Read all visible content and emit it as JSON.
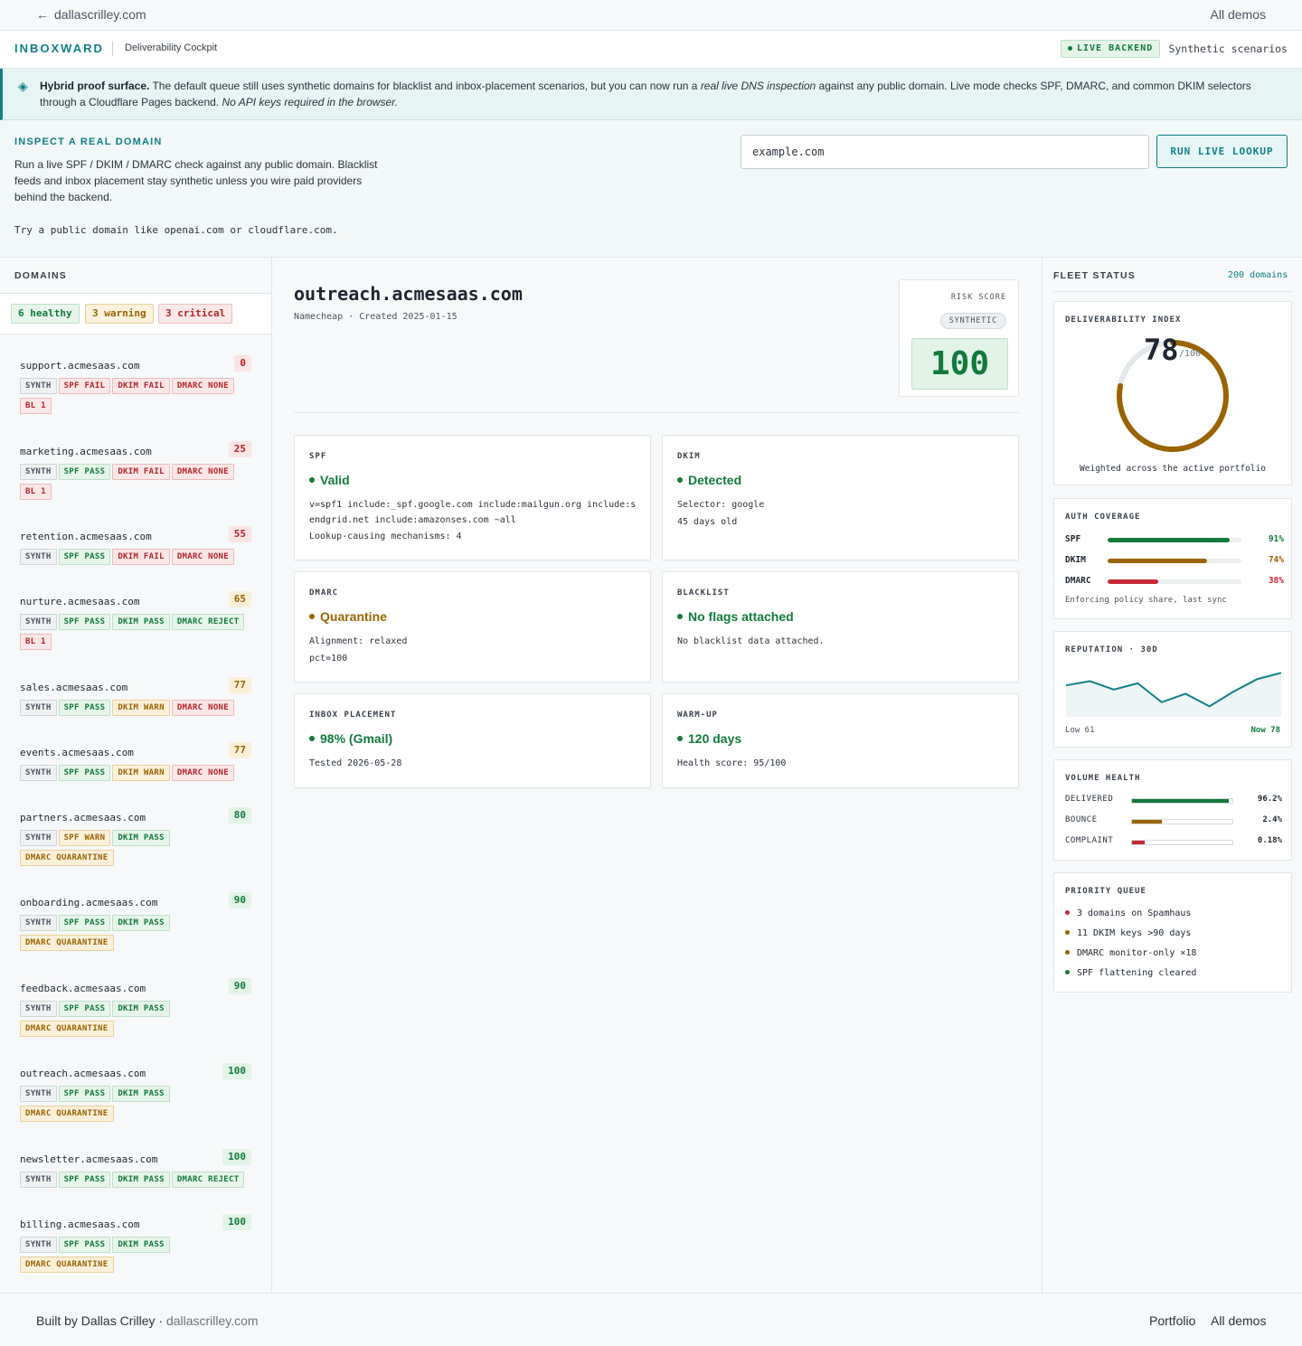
{
  "topbar": {
    "back_label": "dallascrilley.com",
    "all_demos": "All demos"
  },
  "header": {
    "brand": "INBOXWARD",
    "subtitle": "Deliverability Cockpit",
    "live_badge": "LIVE BACKEND",
    "mode_label": "Synthetic scenarios"
  },
  "banner": {
    "lead": "Hybrid proof surface.",
    "text1": " The default queue still uses synthetic domains for blacklist and inbox-placement scenarios, but you can now run a ",
    "em1": "real live DNS inspection",
    "text2": " against any public domain. Live mode checks SPF, DMARC, and common DKIM selectors through a Cloudflare Pages backend. ",
    "em2": "No API keys required in the browser."
  },
  "inspect": {
    "title": "INSPECT A REAL DOMAIN",
    "description": "Run a live SPF / DKIM / DMARC check against any public domain. Blacklist feeds and inbox placement stay synthetic unless you wire paid providers behind the backend.",
    "hint": "Try a public domain like openai.com or cloudflare.com.",
    "input_value": "example.com",
    "button": "RUN LIVE LOOKUP"
  },
  "domains": {
    "title": "DOMAINS",
    "filters": {
      "healthy": "6 healthy",
      "warning": "3 warning",
      "critical": "3 critical"
    },
    "items": [
      {
        "name": "support.acmesaas.com",
        "score": "0",
        "level": "crit",
        "tags": [
          [
            "SYNTH",
            "synth"
          ],
          [
            "SPF FAIL",
            "fail"
          ],
          [
            "DKIM FAIL",
            "fail"
          ],
          [
            "DMARC NONE",
            "fail"
          ],
          [
            "BL 1",
            "fail"
          ]
        ]
      },
      {
        "name": "marketing.acmesaas.com",
        "score": "25",
        "level": "crit",
        "tags": [
          [
            "SYNTH",
            "synth"
          ],
          [
            "SPF PASS",
            "pass"
          ],
          [
            "DKIM FAIL",
            "fail"
          ],
          [
            "DMARC NONE",
            "fail"
          ],
          [
            "BL 1",
            "fail"
          ]
        ]
      },
      {
        "name": "retention.acmesaas.com",
        "score": "55",
        "level": "crit",
        "tags": [
          [
            "SYNTH",
            "synth"
          ],
          [
            "SPF PASS",
            "pass"
          ],
          [
            "DKIM FAIL",
            "fail"
          ],
          [
            "DMARC NONE",
            "fail"
          ]
        ]
      },
      {
        "name": "nurture.acmesaas.com",
        "score": "65",
        "level": "warn",
        "tags": [
          [
            "SYNTH",
            "synth"
          ],
          [
            "SPF PASS",
            "pass"
          ],
          [
            "DKIM PASS",
            "pass"
          ],
          [
            "DMARC REJECT",
            "reject"
          ],
          [
            "BL 1",
            "fail"
          ]
        ]
      },
      {
        "name": "sales.acmesaas.com",
        "score": "77",
        "level": "warn",
        "tags": [
          [
            "SYNTH",
            "synth"
          ],
          [
            "SPF PASS",
            "pass"
          ],
          [
            "DKIM WARN",
            "warn"
          ],
          [
            "DMARC NONE",
            "fail"
          ]
        ]
      },
      {
        "name": "events.acmesaas.com",
        "score": "77",
        "level": "warn",
        "tags": [
          [
            "SYNTH",
            "synth"
          ],
          [
            "SPF PASS",
            "pass"
          ],
          [
            "DKIM WARN",
            "warn"
          ],
          [
            "DMARC NONE",
            "fail"
          ]
        ]
      },
      {
        "name": "partners.acmesaas.com",
        "score": "80",
        "level": "ok",
        "tags": [
          [
            "SYNTH",
            "synth"
          ],
          [
            "SPF WARN",
            "warn"
          ],
          [
            "DKIM PASS",
            "pass"
          ],
          [
            "DMARC QUARANTINE",
            "warn"
          ]
        ]
      },
      {
        "name": "onboarding.acmesaas.com",
        "score": "90",
        "level": "ok",
        "tags": [
          [
            "SYNTH",
            "synth"
          ],
          [
            "SPF PASS",
            "pass"
          ],
          [
            "DKIM PASS",
            "pass"
          ],
          [
            "DMARC QUARANTINE",
            "warn"
          ]
        ]
      },
      {
        "name": "feedback.acmesaas.com",
        "score": "90",
        "level": "ok",
        "tags": [
          [
            "SYNTH",
            "synth"
          ],
          [
            "SPF PASS",
            "pass"
          ],
          [
            "DKIM PASS",
            "pass"
          ],
          [
            "DMARC QUARANTINE",
            "warn"
          ]
        ]
      },
      {
        "name": "outreach.acmesaas.com",
        "score": "100",
        "level": "ok",
        "tags": [
          [
            "SYNTH",
            "synth"
          ],
          [
            "SPF PASS",
            "pass"
          ],
          [
            "DKIM PASS",
            "pass"
          ],
          [
            "DMARC QUARANTINE",
            "warn"
          ]
        ]
      },
      {
        "name": "newsletter.acmesaas.com",
        "score": "100",
        "level": "ok",
        "tags": [
          [
            "SYNTH",
            "synth"
          ],
          [
            "SPF PASS",
            "pass"
          ],
          [
            "DKIM PASS",
            "pass"
          ],
          [
            "DMARC REJECT",
            "reject"
          ]
        ]
      },
      {
        "name": "billing.acmesaas.com",
        "score": "100",
        "level": "ok",
        "tags": [
          [
            "SYNTH",
            "synth"
          ],
          [
            "SPF PASS",
            "pass"
          ],
          [
            "DKIM PASS",
            "pass"
          ],
          [
            "DMARC QUARANTINE",
            "warn"
          ]
        ]
      }
    ]
  },
  "detail": {
    "domain": "outreach.acmesaas.com",
    "meta": "Namecheap · Created 2025-01-15",
    "risk_label": "RISK SCORE",
    "risk_badge": "SYNTHETIC",
    "risk_score": "100",
    "cards": {
      "spf": {
        "title": "SPF",
        "value": "Valid",
        "line1": "v=spf1 include:_spf.google.com include:mailgun.org include:sendgrid.net include:amazonses.com ~all",
        "line2": "Lookup-causing mechanisms: 4"
      },
      "dkim": {
        "title": "DKIM",
        "value": "Detected",
        "line1": "Selector: google",
        "line2": "45 days old"
      },
      "dmarc": {
        "title": "DMARC",
        "value": "Quarantine",
        "line1": "Alignment: relaxed",
        "line2": "pct=100"
      },
      "blacklist": {
        "title": "BLACKLIST",
        "value": "No flags attached",
        "line1": "No blacklist data attached."
      },
      "inbox": {
        "title": "INBOX PLACEMENT",
        "value": "98% (Gmail)",
        "line1": "Tested 2026-05-28"
      },
      "warmup": {
        "title": "WARM-UP",
        "value": "120 days",
        "line1": "Health score: 95/100"
      }
    }
  },
  "fleet": {
    "title": "FLEET STATUS",
    "count": "200 domains",
    "index": {
      "title": "DELIVERABILITY INDEX",
      "value": "78",
      "suffix": "/100",
      "fraction": 0.78,
      "caption": "Weighted across the active portfolio"
    },
    "auth": {
      "title": "AUTH COVERAGE",
      "rows": [
        {
          "label": "SPF",
          "pct": 91,
          "value": "91%",
          "color": "#127a3c"
        },
        {
          "label": "DKIM",
          "pct": 74,
          "value": "74%",
          "color": "#9a6300"
        },
        {
          "label": "DMARC",
          "pct": 38,
          "value": "38%",
          "color": "#c62a35"
        }
      ],
      "caption": "Enforcing policy share, last sync"
    },
    "reputation": {
      "title": "REPUTATION · 30D",
      "low_label": "Low 61",
      "now_label": "Now 78",
      "points": [
        70,
        72,
        68,
        71,
        62,
        66,
        60,
        67,
        73,
        76
      ]
    },
    "volume": {
      "title": "VOLUME HEALTH",
      "rows": [
        {
          "label": "DELIVERED",
          "pct": 96.2,
          "value": "96.2%",
          "color": "#127a3c"
        },
        {
          "label": "BOUNCE",
          "pct": 30,
          "value": "2.4%",
          "color": "#9a6300"
        },
        {
          "label": "COMPLAINT",
          "pct": 13,
          "value": "0.18%",
          "color": "#c62a35"
        }
      ]
    },
    "queue": {
      "title": "PRIORITY QUEUE",
      "items": [
        {
          "text": "3 domains on Spamhaus",
          "color": "#c62a35"
        },
        {
          "text": "11 DKIM keys >90 days",
          "color": "#9a6300"
        },
        {
          "text": "DMARC monitor-only ×18",
          "color": "#9a6300"
        },
        {
          "text": "SPF flattening cleared",
          "color": "#127a3c"
        }
      ]
    }
  },
  "footer": {
    "built_by": "Built by Dallas Crilley",
    "site": "dallascrilley.com",
    "portfolio": "Portfolio",
    "all_demos": "All demos"
  }
}
